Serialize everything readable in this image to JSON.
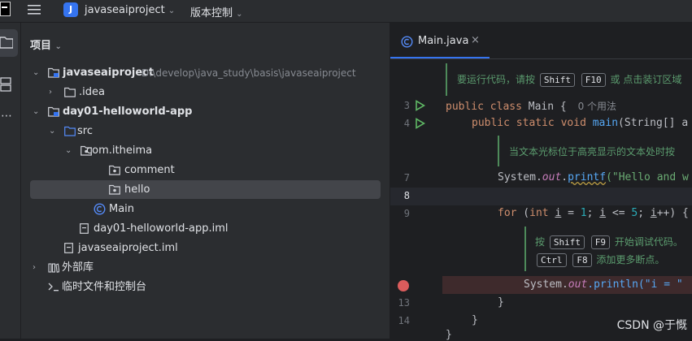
{
  "titlebar": {
    "project_initial": "J",
    "project_name": "javaseaiproject",
    "vcs_label": "版本控制"
  },
  "project_panel": {
    "title": "项目",
    "tree": [
      {
        "label": "javaseaiproject",
        "path": "D:\\develop\\java_study\\basis\\javaseaiproject"
      },
      {
        "label": ".idea"
      },
      {
        "label": "day01-helloworld-app"
      },
      {
        "label": "src"
      },
      {
        "label": "com.itheima"
      },
      {
        "label": "comment"
      },
      {
        "label": "hello"
      },
      {
        "label": "Main"
      },
      {
        "label": "day01-helloworld-app.iml"
      },
      {
        "label": "javaseaiproject.iml"
      },
      {
        "label": "外部库"
      },
      {
        "label": "临时文件和控制台"
      }
    ]
  },
  "editor": {
    "tab_label": "Main.java",
    "lines": [
      "3",
      "4",
      "7",
      "8",
      "9",
      "13",
      "14"
    ],
    "tip_top": {
      "prefix": "要运行代码，请按",
      "key1": "Shift",
      "key2": "F10",
      "suffix": "或 点击装订区域"
    },
    "class_decl": {
      "kw1": "public",
      "kw2": "class",
      "name": "Main {",
      "usages": "0 个用法"
    },
    "main_decl": {
      "kw1": "public",
      "kw2": "static",
      "kw3": "void",
      "fn": "main",
      "rest": "(String[] a"
    },
    "tip_mid": "当文本光标位于高亮显示的文本处时按",
    "printf": {
      "obj": "System.",
      "field": "out",
      "dot": ".",
      "fn": "printf",
      "args": "(\"Hello and w"
    },
    "for_loop": {
      "kw": "for",
      "p1": " (",
      "kw2": "int",
      "v1": "i",
      "p2": " = ",
      "n1": "1",
      "p3": "; ",
      "v2": "i",
      "p4": " <= ",
      "n2": "5",
      "p5": "; ",
      "v3": "i",
      "p6": "++) {"
    },
    "tip_debug": {
      "prefix": "按",
      "key1": "Shift",
      "key2": "F9",
      "suffix": "开始调试代码。"
    },
    "tip_bp": {
      "key1": "Ctrl",
      "key2": "F8",
      "suffix": "添加更多断点。"
    },
    "println": {
      "obj": "System.",
      "field": "out",
      "rest": ".println(\"i = \""
    },
    "brace1": "}",
    "brace2": "}",
    "brace3": "}"
  },
  "watermark": "CSDN @于慨",
  "colors": {
    "accent": "#3574f0",
    "breakpoint": "#db5c5c",
    "run": "#5fb865"
  }
}
